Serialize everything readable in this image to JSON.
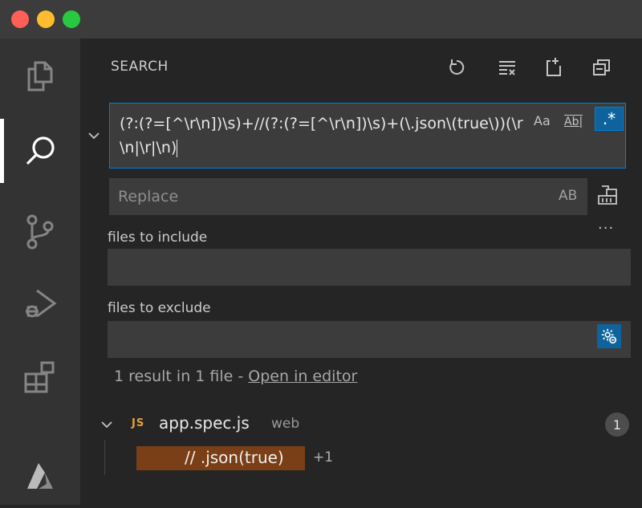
{
  "window": {
    "colors": {
      "close": "#ff5f57",
      "minimize": "#febc2e",
      "zoom": "#28c840"
    }
  },
  "activity_bar": {
    "items": [
      {
        "icon": "explorer-icon"
      },
      {
        "icon": "search-icon",
        "active": true
      },
      {
        "icon": "source-control-icon"
      },
      {
        "icon": "run-debug-icon"
      },
      {
        "icon": "extensions-icon"
      },
      {
        "icon": "azure-icon"
      }
    ]
  },
  "search_panel": {
    "title": "SEARCH",
    "header_actions": [
      "refresh-icon",
      "clear-results-icon",
      "new-search-editor-icon",
      "collapse-all-icon"
    ],
    "search_query": "(?:(?=[^\\r\\n])\\s)+//(?:(?=[^\\r\\n])\\s)+(\\.json\\(true\\))(\\r\\n|\\r|\\n)",
    "options": {
      "match_case": "Aa",
      "whole_word": "Ab|",
      "regex": ".*"
    },
    "replace_placeholder": "Replace",
    "preserve_case": "AB",
    "more": "···",
    "include_label": "files to include",
    "include_value": "",
    "exclude_label": "files to exclude",
    "exclude_value": "",
    "summary_text": "1 result in 1 file - ",
    "summary_link": "Open in editor",
    "results": [
      {
        "lang_badge": "JS",
        "file_name": "app.spec.js",
        "folder": "web",
        "count": "1",
        "match": {
          "text": "// .json(true)",
          "extra": "+1"
        }
      }
    ],
    "colors": {
      "accent": "#007fd4",
      "regex_active": "#0e639c",
      "match_highlight": "#7a3f16",
      "js_badge": "#e6a03a"
    }
  }
}
